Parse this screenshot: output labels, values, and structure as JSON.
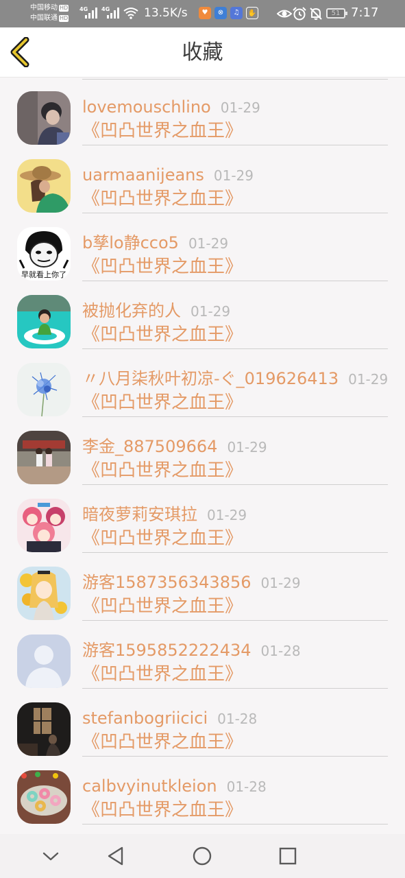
{
  "status_bar": {
    "carrier1": "中国移动",
    "carrier2": "中国联通",
    "hd_badge": "HD",
    "signal_label": "4G",
    "net_speed": "13.5K/s",
    "battery_level": "51",
    "time": "7:17",
    "icons": [
      "signal-icon",
      "wifi-icon",
      "app-notification-icons",
      "eye-icon",
      "alarm-icon",
      "mute-icon",
      "battery-icon"
    ]
  },
  "header": {
    "title": "收藏",
    "back_icon": "chevron-left-icon",
    "accent_color": "#e6c62e"
  },
  "favorites": [
    {
      "user": "lovemouschlino",
      "date": "01-29",
      "title": "《凹凸世界之血王》"
    },
    {
      "user": "uarmaanijeans",
      "date": "01-29",
      "title": "《凹凸世界之血王》"
    },
    {
      "user": "b孳lo静cco5",
      "date": "01-29",
      "title": "《凹凸世界之血王》"
    },
    {
      "user": "被抛化弃的人",
      "date": "01-29",
      "title": "《凹凸世界之血王》"
    },
    {
      "user": "〃八月柒秋叶初凉-ぐ_019626413",
      "date": "01-29",
      "title": "《凹凸世界之血王》"
    },
    {
      "user": "李金_887509664",
      "date": "01-29",
      "title": "《凹凸世界之血王》"
    },
    {
      "user": "暗夜萝莉安琪拉",
      "date": "01-29",
      "title": "《凹凸世界之血王》"
    },
    {
      "user": "游客1587356343856",
      "date": "01-29",
      "title": "《凹凸世界之血王》"
    },
    {
      "user": "游客1595852222434",
      "date": "01-28",
      "title": "《凹凸世界之血王》"
    },
    {
      "user": "stefanbogriicici",
      "date": "01-28",
      "title": "《凹凸世界之血王》"
    },
    {
      "user": "calbvyinutkleion",
      "date": "01-28",
      "title": "《凹凸世界之血王》"
    }
  ],
  "avatar_caption": "早就看上你了",
  "colors": {
    "username": "#e49a66",
    "date": "#b9b9b9",
    "divider": "#d0cfcf",
    "status_bar": "#8a8a8a"
  },
  "nav": {
    "icons": [
      "chevron-down-icon",
      "back-triangle-icon",
      "home-circle-icon",
      "recents-square-icon"
    ]
  }
}
